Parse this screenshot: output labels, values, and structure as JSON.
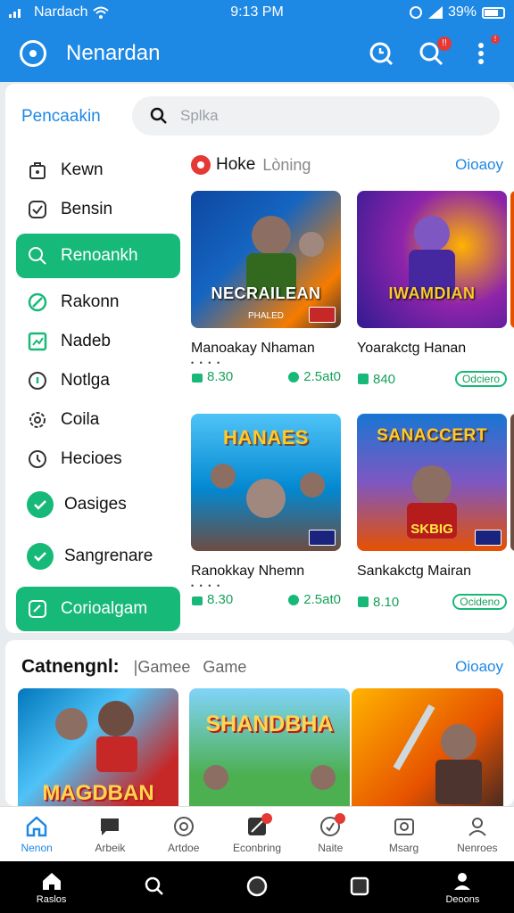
{
  "status_bar": {
    "carrier": "Nardach",
    "time": "9:13 PM",
    "battery": "39%"
  },
  "app_bar": {
    "title": "Nenardan"
  },
  "search": {
    "label": "Pencaakin",
    "placeholder": "Splka"
  },
  "side_nav": [
    {
      "label": "Kewn",
      "icon": "bag-icon"
    },
    {
      "label": "Bensin",
      "icon": "check-icon"
    },
    {
      "label": "Renoankh",
      "icon": "search-icon",
      "active": true
    },
    {
      "label": "Rakonn",
      "icon": "slash-circle-icon"
    },
    {
      "label": "Nadeb",
      "icon": "chart-icon"
    },
    {
      "label": "Notlga",
      "icon": "shield-icon"
    },
    {
      "label": "Coila",
      "icon": "cog-icon"
    },
    {
      "label": "Hecioes",
      "icon": "clock-icon"
    },
    {
      "label": "Oasiges",
      "icon": "check-circle-icon"
    },
    {
      "label": "Sangrenare",
      "icon": "check-circle-icon"
    },
    {
      "label": "Corioalgam",
      "icon": "edit-icon",
      "active": true
    }
  ],
  "hot_section": {
    "title": "Hoke",
    "subtitle": "Lòning",
    "link": "Oioaoy"
  },
  "games": [
    {
      "name": "Manoakay Nhaman",
      "banner": "NECRAILEAN",
      "banner_sub": "PHALED",
      "size": "8.30",
      "players": "2.5at0",
      "tone": "blue"
    },
    {
      "name": "Yoarakctg Hanan",
      "banner": "IWAMDIAN",
      "banner_sub": "",
      "size": "840",
      "players": "Odciero",
      "tone": "purple"
    },
    {
      "name": "Ranokkay Nhemn",
      "banner": "HANAES",
      "banner_sub": "",
      "size": "8.30",
      "players": "2.5at0",
      "tone": "sky"
    },
    {
      "name": "Sankakctg Mairan",
      "banner": "SANACCERT",
      "banner_sub": "SKBIG",
      "size": "8.10",
      "players": "Ocideno",
      "tone": "orange"
    }
  ],
  "category": {
    "title": "Catnengnl:",
    "sub1": "|Gamee",
    "sub2": "Game",
    "link": "Oioaoy",
    "thumbs": [
      {
        "banner": "MAGDBAN"
      },
      {
        "banner": "SHANDBHA"
      },
      {
        "banner": ""
      }
    ]
  },
  "bottom_nav": [
    {
      "label": "Nenon",
      "icon": "home-icon",
      "active": true
    },
    {
      "label": "Arbeik",
      "icon": "chat-icon"
    },
    {
      "label": "Artdoe",
      "icon": "controller-icon"
    },
    {
      "label": "Econbring",
      "icon": "pencil-icon",
      "dot": true
    },
    {
      "label": "Naite",
      "icon": "bell-icon",
      "dot": true
    },
    {
      "label": "Msarg",
      "icon": "photo-icon"
    },
    {
      "label": "Nenroes",
      "icon": "user-icon"
    }
  ],
  "system_nav": [
    {
      "label": "Raslos",
      "icon": "home-icon"
    },
    {
      "label": "",
      "icon": "search-icon"
    },
    {
      "label": "",
      "icon": "circle-icon"
    },
    {
      "label": "",
      "icon": "square-icon"
    },
    {
      "label": "Deoons",
      "icon": "user-icon"
    }
  ],
  "colors": {
    "primary": "#1e88e5",
    "accent": "#17b978",
    "badge": "#e53935"
  }
}
